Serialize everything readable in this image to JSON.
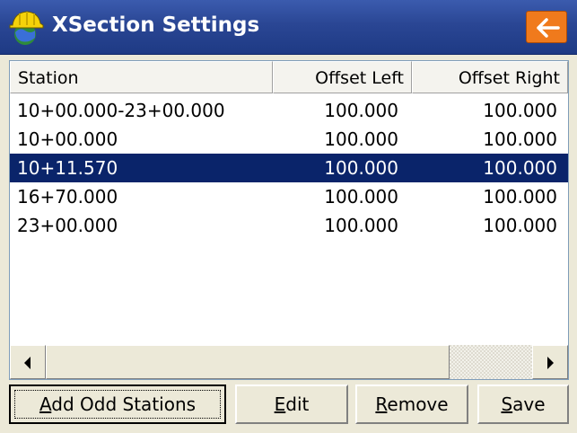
{
  "window": {
    "title": "XSection Settings",
    "icon": "hardhat-globe-icon",
    "back_icon": "arrow-left-icon",
    "accent_color": "#f07a1c"
  },
  "table": {
    "columns": [
      "Station",
      "Offset Left",
      "Offset Right"
    ],
    "rows": [
      [
        "10+00.000-23+00.000",
        "100.000",
        "100.000"
      ],
      [
        "10+00.000",
        "100.000",
        "100.000"
      ],
      [
        "10+11.570",
        "100.000",
        "100.000"
      ],
      [
        "16+70.000",
        "100.000",
        "100.000"
      ],
      [
        "23+00.000",
        "100.000",
        "100.000"
      ]
    ],
    "selected_row": 2,
    "selection_color": "#0a246a"
  },
  "buttons": {
    "add_odd_stations": {
      "mnemonic": "A",
      "rest": "dd Odd Stations"
    },
    "edit": {
      "mnemonic": "E",
      "rest": "dit"
    },
    "remove": {
      "mnemonic": "R",
      "rest": "emove"
    },
    "save": {
      "mnemonic": "S",
      "rest": "ave"
    }
  }
}
